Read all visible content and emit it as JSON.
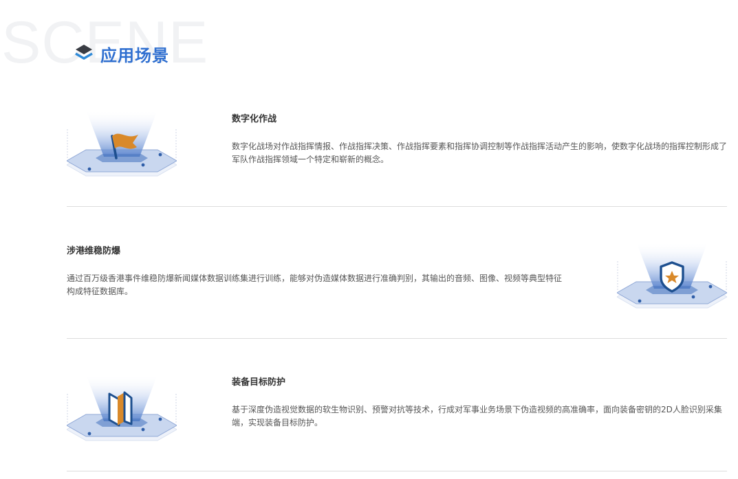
{
  "section": {
    "watermark": "SCENE",
    "title": "应用场景",
    "icon": "layers-icon"
  },
  "scenes": [
    {
      "title": "数字化作战",
      "description": "数字化战场对作战指挥情报、作战指挥决策、作战指挥要素和指挥协调控制等作战指挥活动产生的影响，使数字化战场的指挥控制形成了军队作战指挥领域一个特定和崭新的概念。",
      "icon": "flag-icon"
    },
    {
      "title": "涉港维稳防爆",
      "description": "通过百万级香港事件维稳防爆新闻媒体数据训练集进行训练，能够对伪造媒体数据进行准确判别，其输出的音频、图像、视频等典型特征构成特征数据库。",
      "icon": "shield-star-icon"
    },
    {
      "title": "装备目标防护",
      "description": "基于深度伪造视觉数据的软生物识别、预警对抗等技术，行成对军事业务场景下伪造视频的高准确率，面向装备密钥的2D人脸识别采集端，实现装备目标防护。",
      "icon": "door-icon"
    }
  ],
  "colors": {
    "accent_blue": "#2f6fd0",
    "dark_blue": "#1d4f8f",
    "icon_orange": "#d9892a",
    "platform_blue": "#c9d7ef",
    "watermark_gray": "#f1f2f4",
    "divider_gray": "#dcdcdc"
  }
}
